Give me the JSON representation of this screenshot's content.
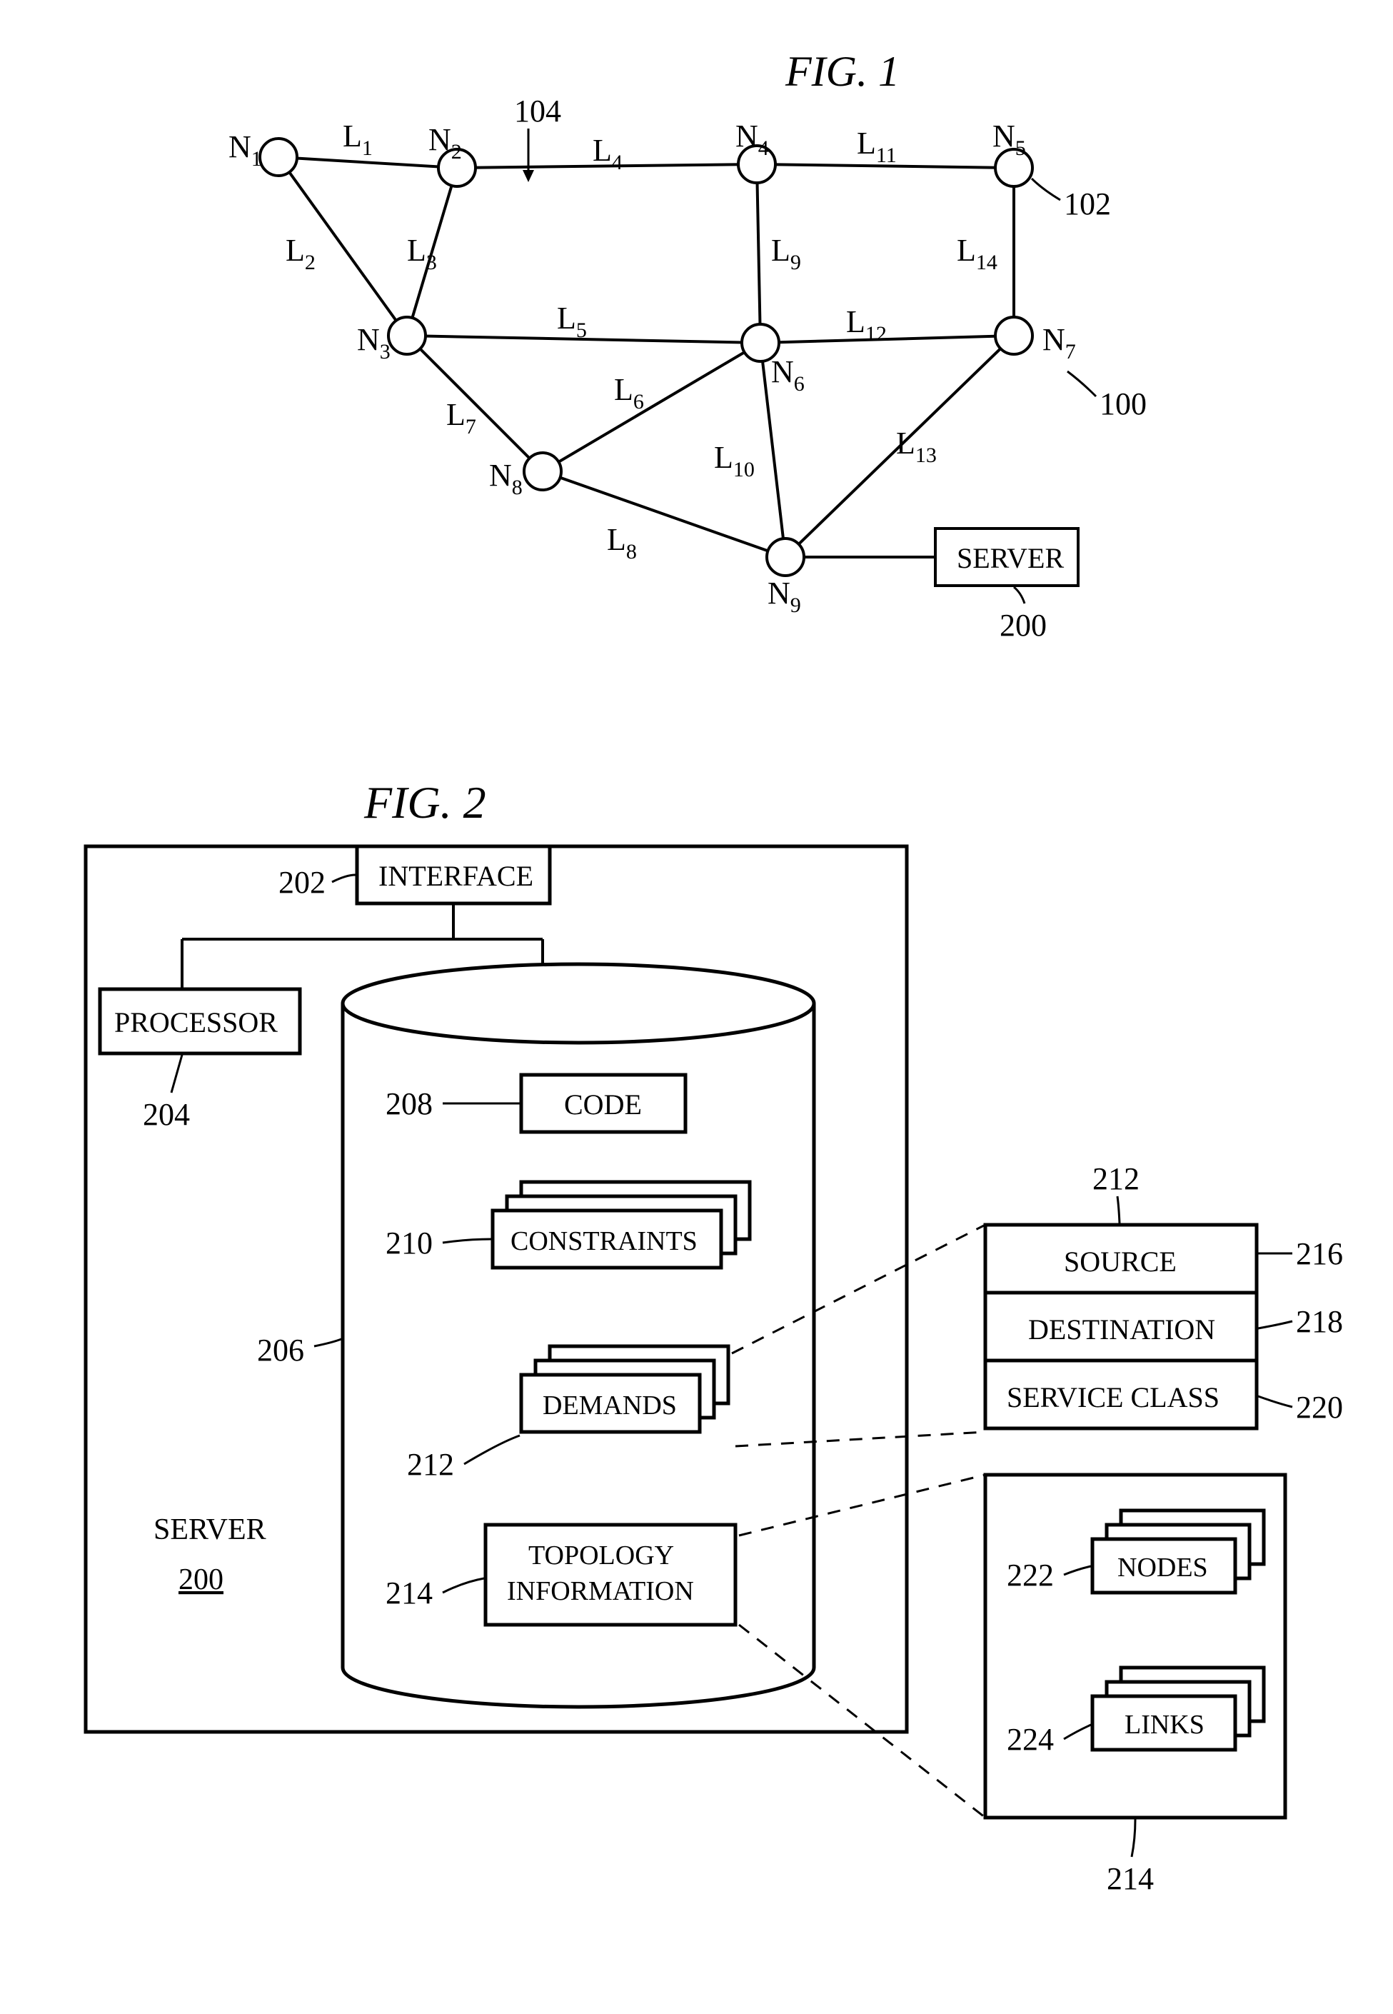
{
  "fig1": {
    "title": "FIG.  1",
    "nodes": [
      {
        "id": "N1",
        "label": "N",
        "sub": "1"
      },
      {
        "id": "N2",
        "label": "N",
        "sub": "2"
      },
      {
        "id": "N3",
        "label": "N",
        "sub": "3"
      },
      {
        "id": "N4",
        "label": "N",
        "sub": "4"
      },
      {
        "id": "N5",
        "label": "N",
        "sub": "5"
      },
      {
        "id": "N6",
        "label": "N",
        "sub": "6"
      },
      {
        "id": "N7",
        "label": "N",
        "sub": "7"
      },
      {
        "id": "N8",
        "label": "N",
        "sub": "8"
      },
      {
        "id": "N9",
        "label": "N",
        "sub": "9"
      }
    ],
    "links": [
      {
        "id": "L1",
        "label": "L",
        "sub": "1"
      },
      {
        "id": "L2",
        "label": "L",
        "sub": "2"
      },
      {
        "id": "L3",
        "label": "L",
        "sub": "3"
      },
      {
        "id": "L4",
        "label": "L",
        "sub": "4"
      },
      {
        "id": "L5",
        "label": "L",
        "sub": "5"
      },
      {
        "id": "L6",
        "label": "L",
        "sub": "6"
      },
      {
        "id": "L7",
        "label": "L",
        "sub": "7"
      },
      {
        "id": "L8",
        "label": "L",
        "sub": "8"
      },
      {
        "id": "L9",
        "label": "L",
        "sub": "9"
      },
      {
        "id": "L10",
        "label": "L",
        "sub": "10"
      },
      {
        "id": "L11",
        "label": "L",
        "sub": "11"
      },
      {
        "id": "L12",
        "label": "L",
        "sub": "12"
      },
      {
        "id": "L13",
        "label": "L",
        "sub": "13"
      },
      {
        "id": "L14",
        "label": "L",
        "sub": "14"
      }
    ],
    "server_label": "SERVER",
    "refs": {
      "r100": "100",
      "r102": "102",
      "r104": "104",
      "r200": "200"
    }
  },
  "fig2": {
    "title": "FIG.  2",
    "interface": "INTERFACE",
    "processor": "PROCESSOR",
    "server_label": "SERVER",
    "server_num": "200",
    "db": {
      "code": "CODE",
      "constraints": "CONSTRAINTS",
      "demands": "DEMANDS",
      "topology": "TOPOLOGY",
      "information": "INFORMATION"
    },
    "demand_detail": {
      "source": "SOURCE",
      "destination": "DESTINATION",
      "service_class": "SERVICE CLASS"
    },
    "topo_detail": {
      "nodes": "NODES",
      "links": "LINKS"
    },
    "refs": {
      "r202": "202",
      "r204": "204",
      "r206": "206",
      "r208": "208",
      "r210": "210",
      "r212": "212",
      "r212b": "212",
      "r214": "214",
      "r214b": "214",
      "r216": "216",
      "r218": "218",
      "r220": "220",
      "r222": "222",
      "r224": "224"
    }
  }
}
